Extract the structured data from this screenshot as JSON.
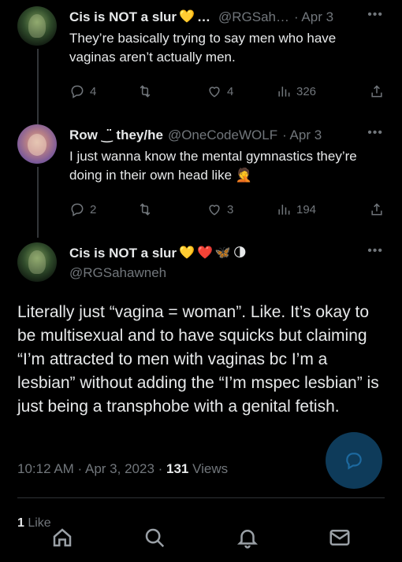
{
  "tweets": [
    {
      "display_name": "Cis is NOT a slur",
      "emojis": [
        "💛"
      ],
      "name_ellipsis": "…",
      "handle": "@RGSah…",
      "time": "· Apr 3",
      "text": "They’re basically trying to say men who have vaginas aren’t actually men.",
      "replies": "4",
      "retweets": "",
      "likes": "4",
      "views": "326"
    },
    {
      "display_name": "Row ‿̈ they/he",
      "emojis": [],
      "handle": "@OneCodeWOLF",
      "time": "· Apr 3",
      "text": "I just wanna know the mental gymnastics they’re doing in their own head like 🤦",
      "replies": "2",
      "retweets": "",
      "likes": "3",
      "views": "194"
    }
  ],
  "main_tweet": {
    "display_name": "Cis is NOT a slur",
    "emojis": [
      "💛",
      "❤️",
      "🦋",
      "🌗"
    ],
    "handle": "@RGSahawneh",
    "text": "Literally just “vagina = woman”. Like. It’s okay to be multisexual and to have squicks but claiming “I’m attracted to men with vaginas bc I’m a lesbian” without adding the “I’m mspec lesbian” is just being a transphobe with a genital fetish.",
    "timestamp": "10:12 AM · Apr 3, 2023 · ",
    "views_count": "131",
    "views_label": " Views",
    "likes_count": "1",
    "likes_label": " Like"
  },
  "icons": {
    "more": "more-horizontal-icon",
    "reply": "reply-icon",
    "retweet": "retweet-icon",
    "like": "heart-icon",
    "views": "views-icon",
    "share": "share-icon",
    "compose": "compose-reply-icon",
    "nav": [
      "home-icon",
      "search-icon",
      "notifications-icon",
      "messages-icon"
    ]
  },
  "colors": {
    "background": "#000000",
    "text": "#e7e9ea",
    "muted": "#71767b",
    "fab": "#0e3b5a"
  }
}
